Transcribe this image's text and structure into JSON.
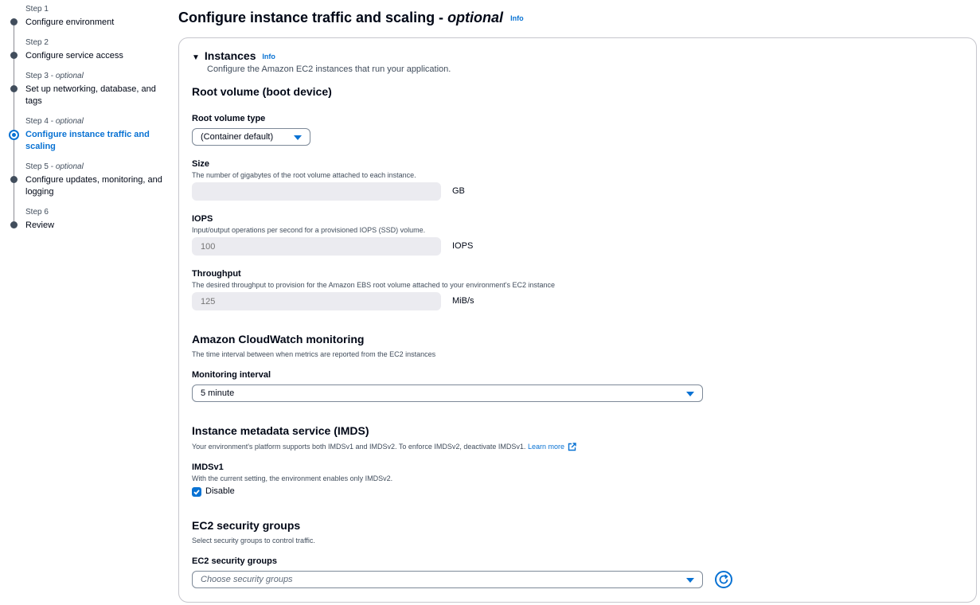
{
  "steps": [
    {
      "number": "Step 1",
      "optional": "",
      "title": "Configure environment",
      "active": false
    },
    {
      "number": "Step 2",
      "optional": "",
      "title": "Configure service access",
      "active": false
    },
    {
      "number": "Step 3 - ",
      "optional": "optional",
      "title": "Set up networking, database, and tags",
      "active": false
    },
    {
      "number": "Step 4 - ",
      "optional": "optional",
      "title": "Configure instance traffic and scaling",
      "active": true
    },
    {
      "number": "Step 5 - ",
      "optional": "optional",
      "title": "Configure updates, monitoring, and logging",
      "active": false
    },
    {
      "number": "Step 6",
      "optional": "",
      "title": "Review",
      "active": false
    }
  ],
  "page": {
    "title": "Configure instance traffic and scaling - ",
    "title_optional": "optional",
    "info": "Info"
  },
  "instances": {
    "heading": "Instances",
    "info": "Info",
    "description": "Configure the Amazon EC2 instances that run your application.",
    "root_volume_heading": "Root volume (boot device)",
    "root_volume_type_label": "Root volume type",
    "root_volume_type_value": "(Container default)",
    "size_label": "Size",
    "size_desc": "The number of gigabytes of the root volume attached to each instance.",
    "size_value": "",
    "size_unit": "GB",
    "iops_label": "IOPS",
    "iops_desc": "Input/output operations per second for a provisioned IOPS (SSD) volume.",
    "iops_placeholder": "100",
    "iops_unit": "IOPS",
    "throughput_label": "Throughput",
    "throughput_desc": "The desired throughput to provision for the Amazon EBS root volume attached to your environment's EC2 instance",
    "throughput_placeholder": "125",
    "throughput_unit": "MiB/s"
  },
  "cloudwatch": {
    "heading": "Amazon CloudWatch monitoring",
    "desc": "The time interval between when metrics are reported from the EC2 instances",
    "interval_label": "Monitoring interval",
    "interval_value": "5 minute"
  },
  "imds": {
    "heading": "Instance metadata service (IMDS)",
    "desc": "Your environment's platform supports both IMDSv1 and IMDSv2. To enforce IMDSv2, deactivate IMDSv1.",
    "learn_more": "Learn more",
    "v1_label": "IMDSv1",
    "v1_desc": "With the current setting, the environment enables only IMDSv2.",
    "disable_label": "Disable",
    "disable_checked": true
  },
  "security_groups": {
    "heading": "EC2 security groups",
    "desc": "Select security groups to control traffic.",
    "label": "EC2 security groups",
    "placeholder": "Choose security groups"
  },
  "colors": {
    "accent": "#0972d3",
    "text": "#000716",
    "muted": "#414d5c",
    "disabled_bg": "#ebebf0"
  }
}
